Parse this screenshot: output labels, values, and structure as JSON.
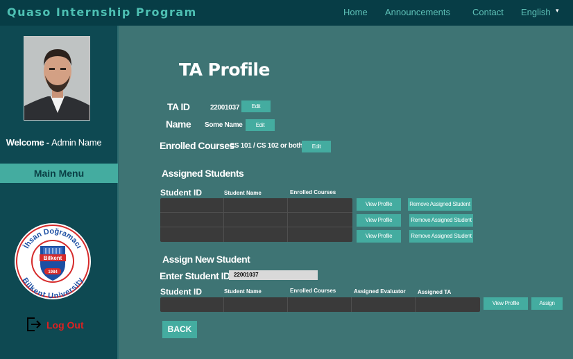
{
  "header": {
    "brand": "Quaso Internship Program",
    "nav": {
      "home": "Home",
      "announcements": "Announcements",
      "contact": "Contact",
      "language": "English"
    }
  },
  "sidebar": {
    "welcome_bold": "Welcome - ",
    "welcome_name": "Admin Name",
    "main_menu": "Main Menu",
    "logo_text_top": "İhsan Doğramacı",
    "logo_text_bottom": "Bilkent University",
    "logo_banner": "Bilkent",
    "logo_year": "1984",
    "logout": "Log Out"
  },
  "profile": {
    "title": "TA Profile",
    "ta_id_label": "TA  ID",
    "ta_id_value": "22001037",
    "name_label": "Name",
    "name_value": "Some Name",
    "courses_label": "Enrolled Courses",
    "courses_value": "CS 101 / CS 102 or both",
    "edit_label": "Edit"
  },
  "assigned_students": {
    "heading": "Assigned Students",
    "columns": {
      "student_id": "Student ID",
      "student_name": "Student Name",
      "enrolled_courses": "Enrolled Courses"
    },
    "rows": [
      {
        "view": "View Profile",
        "remove": "Remove Assigned Student"
      },
      {
        "view": "View Profile",
        "remove": "Remove Assigned Student"
      },
      {
        "view": "View Profile",
        "remove": "Remove Assigned Student"
      }
    ]
  },
  "assign_new": {
    "heading": "Assign New Student",
    "enter_label": "Enter Student ID",
    "input_value": "22001037",
    "columns": {
      "student_id": "Student ID",
      "student_name": "Student Name",
      "enrolled_courses": "Enrolled Courses",
      "assigned_evaluator": "Assigned Evaluator",
      "assigned_ta": "Assigned TA"
    },
    "view_profile": "View Profile",
    "assign": "Assign"
  },
  "back_label": "BACK",
  "colors": {
    "topbar": "#073d46",
    "sidebar": "#0e4952",
    "main_bg": "#3e7474",
    "accent": "#44aca0",
    "logout": "#e02020",
    "table": "#3a3a3a"
  }
}
